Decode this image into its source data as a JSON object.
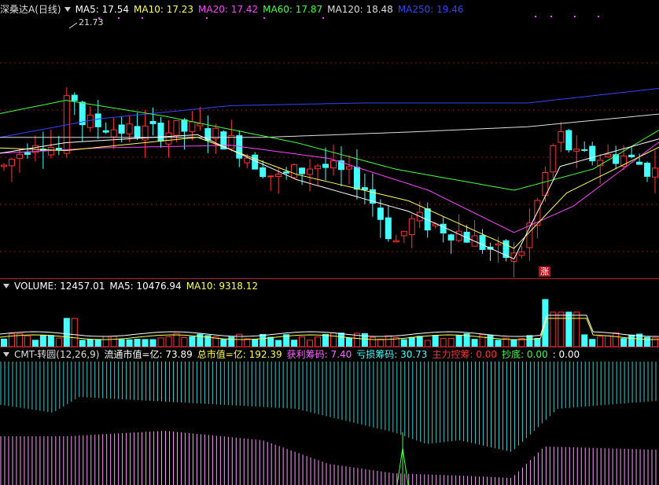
{
  "main": {
    "title": "深桑达A(日线)",
    "indicators": [
      {
        "label": "MA5: 17.54",
        "color": "#ffffff"
      },
      {
        "label": "MA10: 17.23",
        "color": "#ffff55"
      },
      {
        "label": "MA20: 17.42",
        "color": "#ff44ff"
      },
      {
        "label": "MA60: 17.87",
        "color": "#44ff44"
      },
      {
        "label": "MA120: 18.48",
        "color": "#dddddd"
      },
      {
        "label": "MA250: 19.46",
        "color": "#3344ff"
      }
    ],
    "high_label": "21.73",
    "zhang_tag": "涨"
  },
  "volume": {
    "indicators": [
      {
        "label": "VOLUME: 12457.01",
        "color": "#ffffff"
      },
      {
        "label": "MA5: 10476.94",
        "color": "#ffffff"
      },
      {
        "label": "MA10: 9318.12",
        "color": "#ffff55"
      }
    ]
  },
  "cmt": {
    "indicators": [
      {
        "label": "CMT-转圆(12,26,9)",
        "color": "#dddddd"
      },
      {
        "label": "流通市值=亿: 73.89",
        "color": "#ffffff"
      },
      {
        "label": "总市值=亿: 192.39",
        "color": "#ffff55"
      },
      {
        "label": "获利筹码: 7.40",
        "color": "#ff66ff"
      },
      {
        "label": "亏损筹码: 30.73",
        "color": "#44ffff"
      },
      {
        "label": "主力控筹: 0.00",
        "color": "#ff3333"
      },
      {
        "label": "抄底: 0.00",
        "color": "#44ff44"
      },
      {
        "label": ": 0.00",
        "color": "#ffffff"
      }
    ]
  },
  "chart_data": [
    {
      "type": "candlestick",
      "title": "深桑达A(日线)",
      "series": [
        {
          "name": "MA5"
        },
        {
          "name": "MA10"
        },
        {
          "name": "MA20"
        },
        {
          "name": "MA60"
        },
        {
          "name": "MA120"
        },
        {
          "name": "MA250"
        }
      ],
      "annotations": [
        "21.73"
      ],
      "ma_anchors": {
        "ma250": [
          [
            0,
            17.6
          ],
          [
            0.15,
            18.3
          ],
          [
            0.35,
            18.8
          ],
          [
            0.55,
            18.9
          ],
          [
            0.8,
            18.9
          ],
          [
            1,
            19.45
          ]
        ],
        "ma120": [
          [
            0,
            17.6
          ],
          [
            0.15,
            17.6
          ],
          [
            0.4,
            17.6
          ],
          [
            0.62,
            17.8
          ],
          [
            0.8,
            18.0
          ],
          [
            1,
            18.48
          ]
        ],
        "ma60": [
          [
            0,
            18.5
          ],
          [
            0.1,
            19.0
          ],
          [
            0.25,
            18.4
          ],
          [
            0.45,
            17.4
          ],
          [
            0.6,
            16.4
          ],
          [
            0.78,
            15.6
          ],
          [
            0.9,
            16.4
          ],
          [
            1,
            17.87
          ]
        ],
        "ma20": [
          [
            0,
            17.0
          ],
          [
            0.15,
            17.2
          ],
          [
            0.35,
            17.3
          ],
          [
            0.5,
            16.8
          ],
          [
            0.65,
            15.6
          ],
          [
            0.78,
            14.0
          ],
          [
            0.87,
            15.0
          ],
          [
            1,
            17.42
          ]
        ],
        "ma10": [
          [
            0,
            17.2
          ],
          [
            0.1,
            17.1
          ],
          [
            0.3,
            17.6
          ],
          [
            0.45,
            16.2
          ],
          [
            0.62,
            15.2
          ],
          [
            0.78,
            13.4
          ],
          [
            0.86,
            15.5
          ],
          [
            1,
            17.23
          ]
        ],
        "ma5": [
          [
            0,
            17.0
          ],
          [
            0.1,
            17.4
          ],
          [
            0.3,
            17.7
          ],
          [
            0.45,
            16.0
          ],
          [
            0.62,
            14.8
          ],
          [
            0.78,
            13.0
          ],
          [
            0.85,
            16.5
          ],
          [
            1,
            17.54
          ]
        ]
      }
    },
    {
      "type": "bar",
      "series": [
        {
          "name": "VOLUME",
          "last": 12457.01
        },
        {
          "name": "MA5",
          "last": 10476.94
        },
        {
          "name": "MA10",
          "last": 9318.12
        }
      ]
    },
    {
      "type": "bar",
      "series": [
        {
          "name": "获利筹码",
          "last": 7.4
        },
        {
          "name": "亏损筹码",
          "last": 30.73
        }
      ]
    }
  ]
}
